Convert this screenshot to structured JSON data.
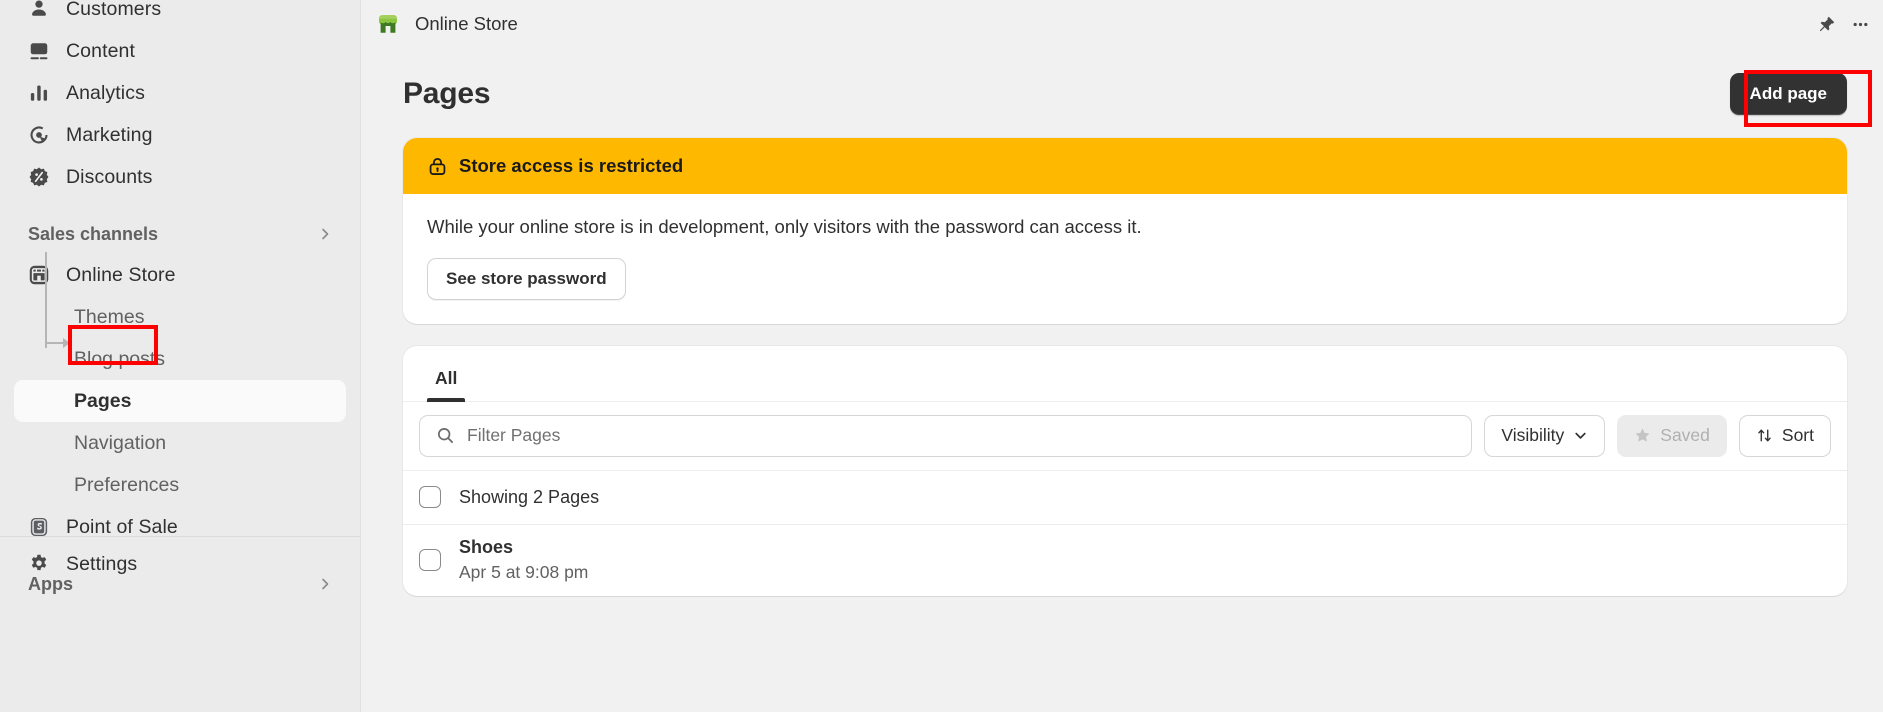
{
  "sidebar": {
    "primary_items": [
      {
        "label": "Customers",
        "icon": "person-icon"
      },
      {
        "label": "Content",
        "icon": "content-image-icon"
      },
      {
        "label": "Analytics",
        "icon": "bar-chart-icon"
      },
      {
        "label": "Marketing",
        "icon": "target-cursor-icon"
      },
      {
        "label": "Discounts",
        "icon": "discount-tag-icon"
      }
    ],
    "sales_channels": {
      "label": "Sales channels",
      "chevron": "chevron-right-icon"
    },
    "online_store": {
      "label": "Online Store",
      "icon": "storefront-icon"
    },
    "online_store_children": [
      {
        "label": "Themes",
        "active": false
      },
      {
        "label": "Blog posts",
        "active": false
      },
      {
        "label": "Pages",
        "active": true
      },
      {
        "label": "Navigation",
        "active": false
      },
      {
        "label": "Preferences",
        "active": false
      }
    ],
    "point_of_sale": {
      "label": "Point of Sale",
      "icon": "pos-bag-icon"
    },
    "apps": {
      "label": "Apps",
      "chevron": "chevron-right-icon"
    },
    "settings": {
      "label": "Settings",
      "icon": "gear-icon"
    }
  },
  "topbar": {
    "store_icon": "storefront-green-icon",
    "title": "Online Store",
    "pin_icon": "pin-icon",
    "more_icon": "more-horizontal-icon"
  },
  "page": {
    "title": "Pages",
    "add_page_label": "Add page"
  },
  "banner": {
    "lock_icon": "lock-icon",
    "heading": "Store access is restricted",
    "body": "While your online store is in development, only visitors with the password can access it.",
    "action_label": "See store password",
    "accent_color": "#ffb800"
  },
  "list": {
    "tabs": [
      {
        "label": "All",
        "active": true
      }
    ],
    "search": {
      "placeholder": "Filter Pages",
      "value": "",
      "icon": "search-icon"
    },
    "visibility_button": {
      "label": "Visibility",
      "icon": "chevron-down-icon"
    },
    "saved_button": {
      "label": "Saved",
      "icon": "star-icon",
      "disabled": true
    },
    "sort_button": {
      "label": "Sort",
      "icon": "sort-arrows-icon"
    },
    "showing_label": "Showing 2 Pages",
    "rows": [
      {
        "title": "Shoes",
        "subtitle": "Apr 5 at 9:08 pm"
      }
    ]
  },
  "highlights": {
    "pages_nav": "#ff0000",
    "add_page_button": "#ff0000"
  }
}
